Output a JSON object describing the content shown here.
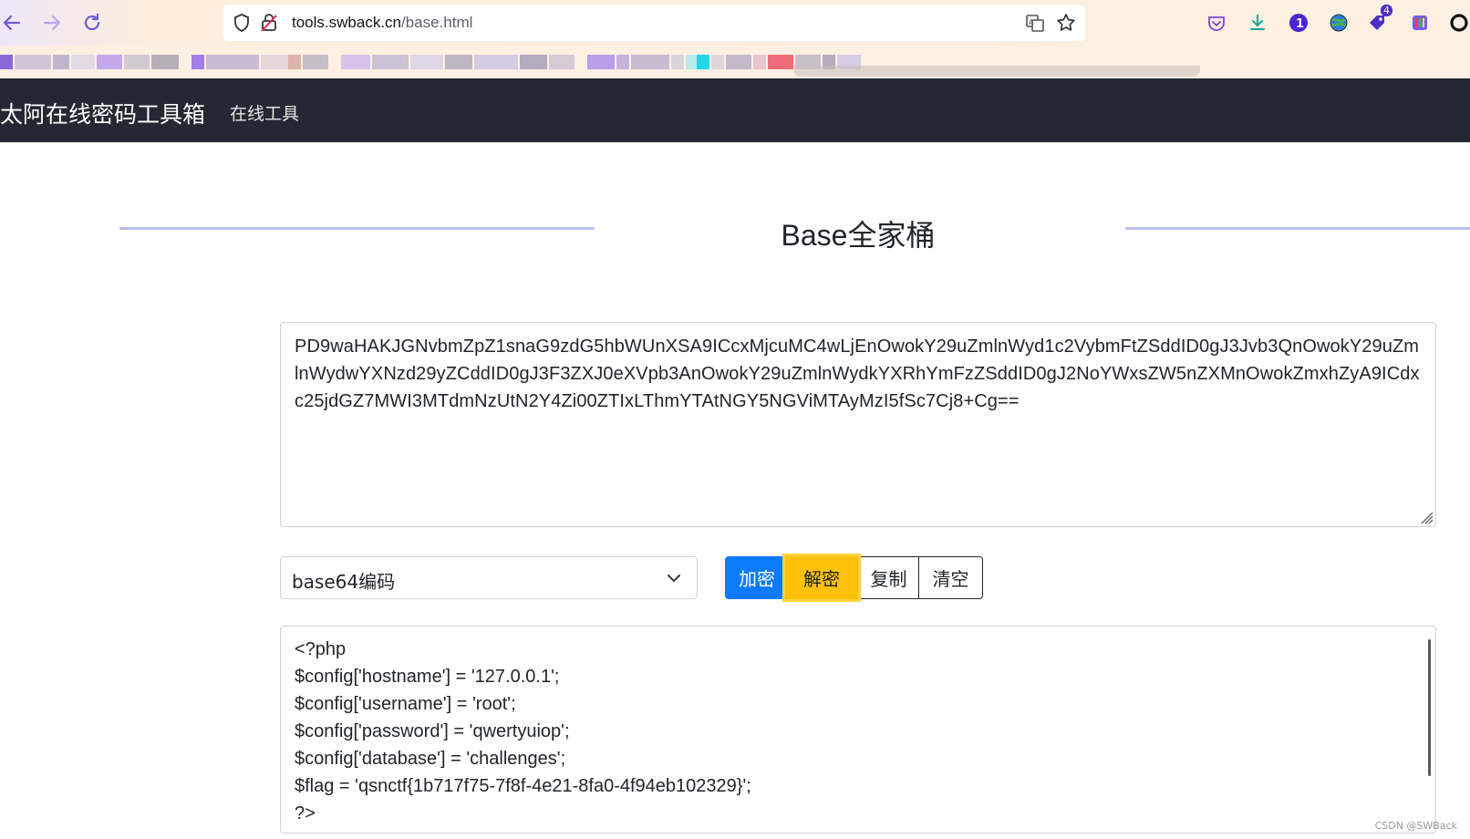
{
  "browser": {
    "url_host": "tools.swback.cn",
    "url_path": "/base.html",
    "extension_badge_count": "4"
  },
  "navbar": {
    "brand": "太阿在线密码工具箱",
    "link_tools": "在线工具"
  },
  "page": {
    "title": "Base全家桶"
  },
  "input": {
    "value": "PD9waHAKJGNvbmZpZ1snaG9zdG5hbWUnXSA9ICcxMjcuMC4wLjEnOwokY29uZmlnWyd1c2VybmFtZSddID0gJ3Jvb3QnOwokY29uZmlnWydwYXNzd29yZCddID0gJ3F3ZXJ0eXVpb3AnOwokY29uZmlnWydkYXRhYmFzZSddID0gJ2NoYWxsZW5nZXMnOwokZmxhZyA9ICdxc25jdGZ7MWI3MTdmNzUtN2Y4Zi00ZTIxLThmYTAtNGY5NGViMTAyMzI5fSc7Cj8+Cg=="
  },
  "controls": {
    "select_value": "base64编码",
    "encrypt_label": "加密",
    "decrypt_label": "解密",
    "copy_label": "复制",
    "clear_label": "清空"
  },
  "output": {
    "lines": [
      "<?php",
      "$config['hostname'] = '127.0.0.1';",
      "$config['username'] = 'root';",
      "$config['password'] = 'qwertyuiop';",
      "$config['database'] = 'challenges';",
      "$flag = 'qsnctf{1b717f75-7f8f-4e21-8fa0-4f94eb102329}';",
      "?>"
    ]
  },
  "watermark": "CSDN @SWBack",
  "colors": {
    "navbar_bg": "#232832",
    "encrypt_btn": "#0d7bff",
    "decrypt_btn": "#ffc107",
    "title_line": "#bcbdf5"
  }
}
